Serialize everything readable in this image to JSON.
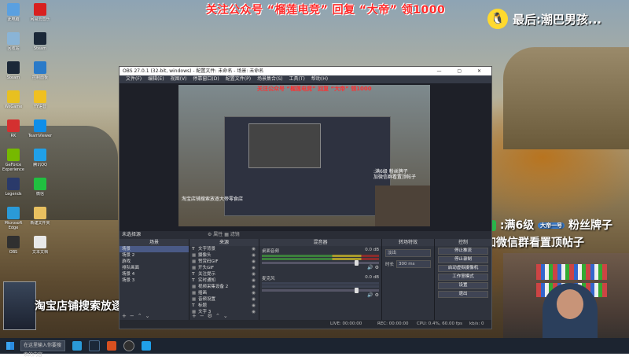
{
  "banner": "关注公众号 “榴莲电竞” 回复 “大帝” 领1000",
  "top_right": "最后:潮巴男孩...",
  "fan_message": {
    "line1": ":满6级",
    "badge": "大帝一号",
    "line1_rest": "粉丝牌子",
    "line2": "加微信群看置顶帖子"
  },
  "taobao": "淘宝店铺搜索放逐大帝零食店",
  "desktop_icons": [
    {
      "label": "此电脑",
      "color": "#5aa0e0"
    },
    {
      "label": "回收站",
      "color": "#8ab4d6"
    },
    {
      "label": "Steam",
      "color": "#1b2838"
    },
    {
      "label": "WeGame",
      "color": "#e8c020"
    },
    {
      "label": "RK",
      "color": "#d43030"
    },
    {
      "label": "GeForce Experience",
      "color": "#76b900"
    },
    {
      "label": "Legends",
      "color": "#2a3a6a"
    },
    {
      "label": "Microsoft Edge",
      "color": "#2a9ad8"
    },
    {
      "label": "OBS",
      "color": "#303030"
    },
    {
      "label": "网易云音乐",
      "color": "#d82020"
    },
    {
      "label": "Steam",
      "color": "#1b2838"
    },
    {
      "label": "控制面板",
      "color": "#2a7ac8"
    },
    {
      "label": "YY语音",
      "color": "#f0c020"
    },
    {
      "label": "TeamViewer",
      "color": "#0e8ee9"
    },
    {
      "label": "腾讯QQ",
      "color": "#20a0e8"
    },
    {
      "label": "微信",
      "color": "#20c040"
    },
    {
      "label": "新建文件夹",
      "color": "#e8c060"
    },
    {
      "label": "文本文档",
      "color": "#e8e8e8"
    }
  ],
  "obs": {
    "title": "OBS 27.0.1 (32-bit, windows) - 配置文件: 未命名 - 场景: 未命名",
    "window_controls": "—  ▢  ✕",
    "menu": [
      "文件(F)",
      "编辑(E)",
      "视图(V)",
      "停靠窗口(D)",
      "配置文件(P)",
      "场景集合(S)",
      "工具(T)",
      "帮助(H)"
    ],
    "inner_banner": "关注公众号 “榴莲电竞” 回复 “大帝” 领1000",
    "inner_fan": ":满6级 粉丝牌子\n加微信群看置顶帖子",
    "inner_taobao": "淘宝店铺搜索放逐大帝零食店",
    "scene_bar": "未选择源",
    "scene_bar_mid": "⚙ 属性   ▦ 滤镜",
    "scenes_header": "场景",
    "scenes": [
      "场景",
      "场景 2",
      "游戏",
      "排队画面",
      "场景 4",
      "场景 3"
    ],
    "sources_header": "来源",
    "sources": [
      {
        "t": "T",
        "name": "文字背景"
      },
      {
        "t": "▦",
        "name": "摄像头"
      },
      {
        "t": "▦",
        "name": "赞赏码GIF"
      },
      {
        "t": "▦",
        "name": "开头GIF"
      },
      {
        "t": "T",
        "name": "关注提示"
      },
      {
        "t": "T",
        "name": "实时通知"
      },
      {
        "t": "▦",
        "name": "视频采集设备 2"
      },
      {
        "t": "▦",
        "name": "插画"
      },
      {
        "t": "▦",
        "name": "音频设置"
      },
      {
        "t": "T",
        "name": "标题"
      },
      {
        "t": "▦",
        "name": "文字 3"
      }
    ],
    "mixer_header": "混音器",
    "mixer": [
      {
        "name": "桌面音频",
        "db": "0.0 dB"
      },
      {
        "name": "麦克风",
        "db": "0.0 dB"
      }
    ],
    "transitions_header": "转场特效",
    "transition_type": "淡出",
    "duration_label": "时长",
    "duration_value": "300 ms",
    "controls_header": "控制",
    "controls": [
      "停止推流",
      "停止录制",
      "启动虚拟摄像机",
      "工作室模式",
      "设置",
      "退出"
    ],
    "status": {
      "live": "LIVE: 00:00:00",
      "rec": "REC: 00:00:00",
      "cpu": "CPU: 0.4%, 60.00 fps",
      "kbs": "kb/s: 0"
    }
  },
  "taskbar": {
    "search_placeholder": "在这里输入你要搜索的内容"
  },
  "colors": {
    "banner_red": "#ff2a2a",
    "obs_bg": "#2b2e38",
    "selection": "#4a5a86"
  }
}
